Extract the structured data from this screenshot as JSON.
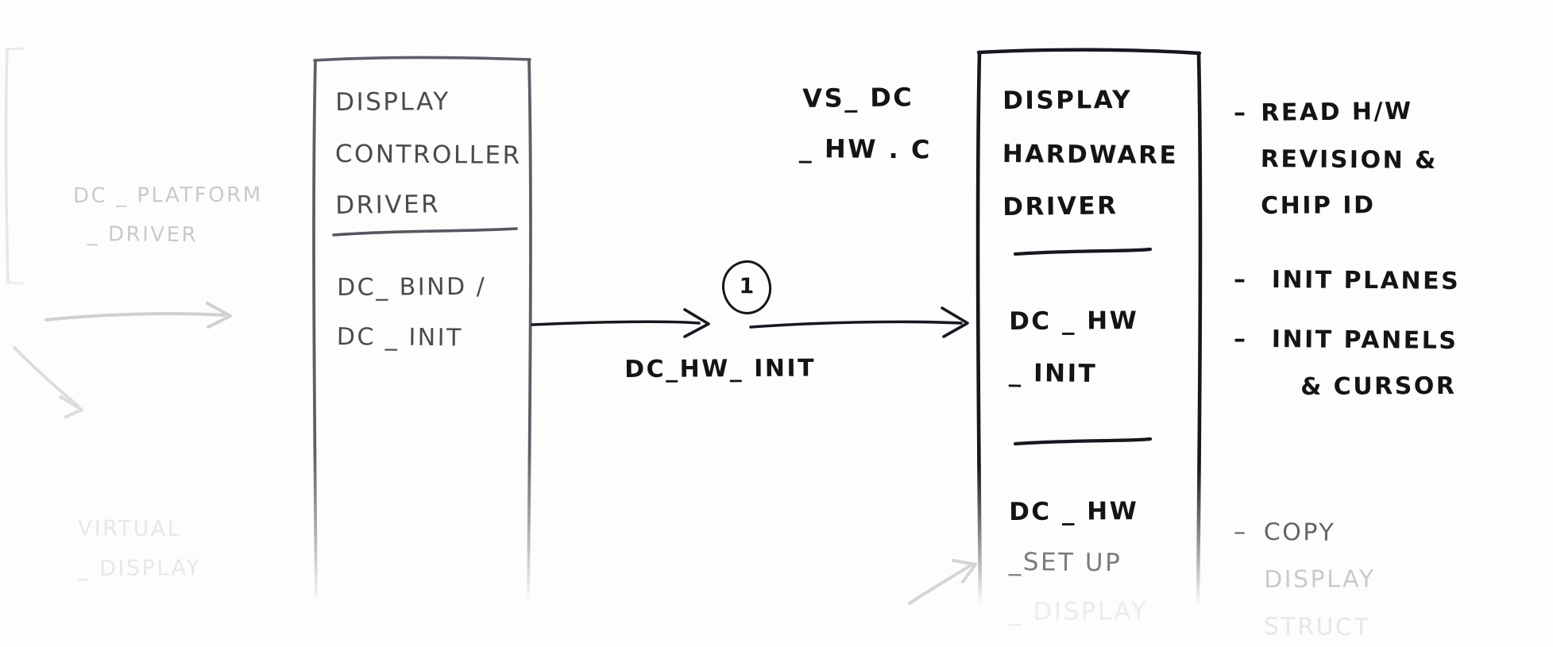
{
  "diagram": {
    "title": "Display Controller Driver to Display Hardware Driver call flow",
    "colors": {
      "ink_dark": "#141414",
      "ink_mid": "#4a4a50",
      "ink_faint": "#c9cace",
      "ink_ghost": "#e6e7ea",
      "background": "#fdfdfd"
    }
  },
  "left_faded": {
    "platform_driver": {
      "line1": "DC _ PLATFORM",
      "line2": "_ DRIVER"
    },
    "virtual_display": {
      "line1": "VIRTUAL",
      "line2": "_ DISPLAY"
    }
  },
  "controller_box": {
    "header": {
      "line1": "DISPLAY",
      "line2": "CONTROLLER",
      "line3": "DRIVER"
    },
    "body": {
      "line1": "DC_ BIND /",
      "line2": "DC _ INIT"
    }
  },
  "file_label": {
    "line1": "VS_ DC",
    "line2": "_ HW . C"
  },
  "connector": {
    "marker": "1",
    "label": "DC_HW_ INIT"
  },
  "hardware_box": {
    "header": {
      "line1": "DISPLAY",
      "line2": "HARDWARE",
      "line3": "DRIVER"
    },
    "section_init": {
      "line1": "DC _ HW",
      "line2": "_ INIT"
    },
    "section_setup": {
      "line1": "DC _ HW",
      "line2": "_SET UP",
      "line3": "_ DISPLAY"
    }
  },
  "notes_init": [
    {
      "bullet": "–",
      "line1": "READ H/W",
      "line2": "REVISION &",
      "line3": "CHIP ID"
    },
    {
      "bullet": "–",
      "line1": "INIT PLANES"
    },
    {
      "bullet": "–",
      "line1": "INIT PANELS",
      "line2": "& CURSOR"
    }
  ],
  "notes_setup": [
    {
      "bullet": "–",
      "line1": "COPY",
      "line2": "DISPLAY",
      "line3": "STRUCT"
    }
  ]
}
